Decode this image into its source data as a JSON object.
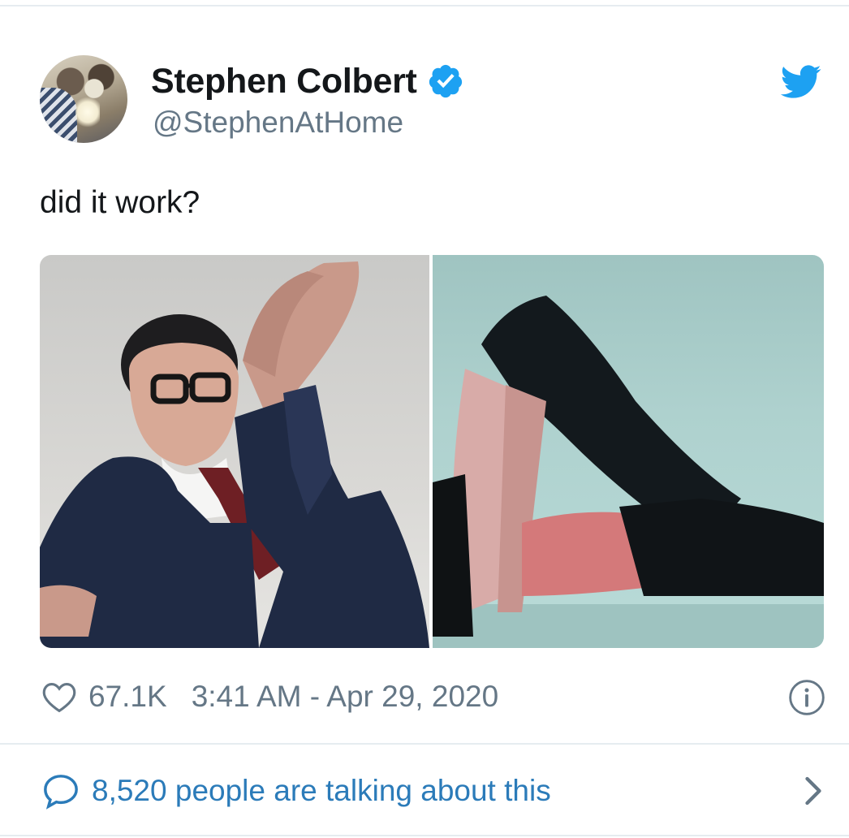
{
  "tweet": {
    "author": {
      "name": "Stephen Colbert",
      "handle": "@StephenAtHome",
      "verified": true
    },
    "text": "did it work?",
    "media": {
      "count": 2
    },
    "likes": "67.1K",
    "timestamp": "3:41 AM - Apr 29, 2020",
    "conversation": "8,520 people are talking about this"
  },
  "icons": {
    "verified": "verified-badge-icon",
    "brand": "twitter-bird-icon",
    "like": "heart-icon",
    "info": "info-icon",
    "reply": "speech-bubble-icon",
    "open": "chevron-right-icon"
  },
  "colors": {
    "twitter_blue": "#1da1f2",
    "link_blue": "#2b7bb9",
    "secondary_text": "#657786",
    "primary_text": "#14171a",
    "divider": "#e6ecf0"
  }
}
